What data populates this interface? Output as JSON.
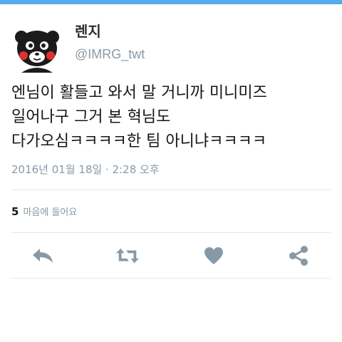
{
  "user": {
    "display_name": "렌지",
    "handle": "@IMRG_twt"
  },
  "tweet": {
    "lines": [
      "엔님이 활들고 와서 말 거니까 미니미즈",
      "일어나구 그거 본 혁님도",
      "다가오심ㅋㅋㅋㅋ한 팀 아니냐ㅋㅋㅋㅋ"
    ],
    "timestamp": "2016년 01월 18일 · 2:28 오후"
  },
  "stats": {
    "like_count": "5",
    "like_label": "마음에 들어요"
  },
  "actions": [
    {
      "name": "reply",
      "icon": "reply-icon"
    },
    {
      "name": "retweet",
      "icon": "retweet-icon"
    },
    {
      "name": "like",
      "icon": "heart-icon"
    },
    {
      "name": "share",
      "icon": "share-icon"
    }
  ],
  "colors": {
    "accent": "#55acee",
    "text": "#14171a",
    "muted": "#8899a6",
    "icon": "#8899a6",
    "divider": "#e1e8ed"
  }
}
